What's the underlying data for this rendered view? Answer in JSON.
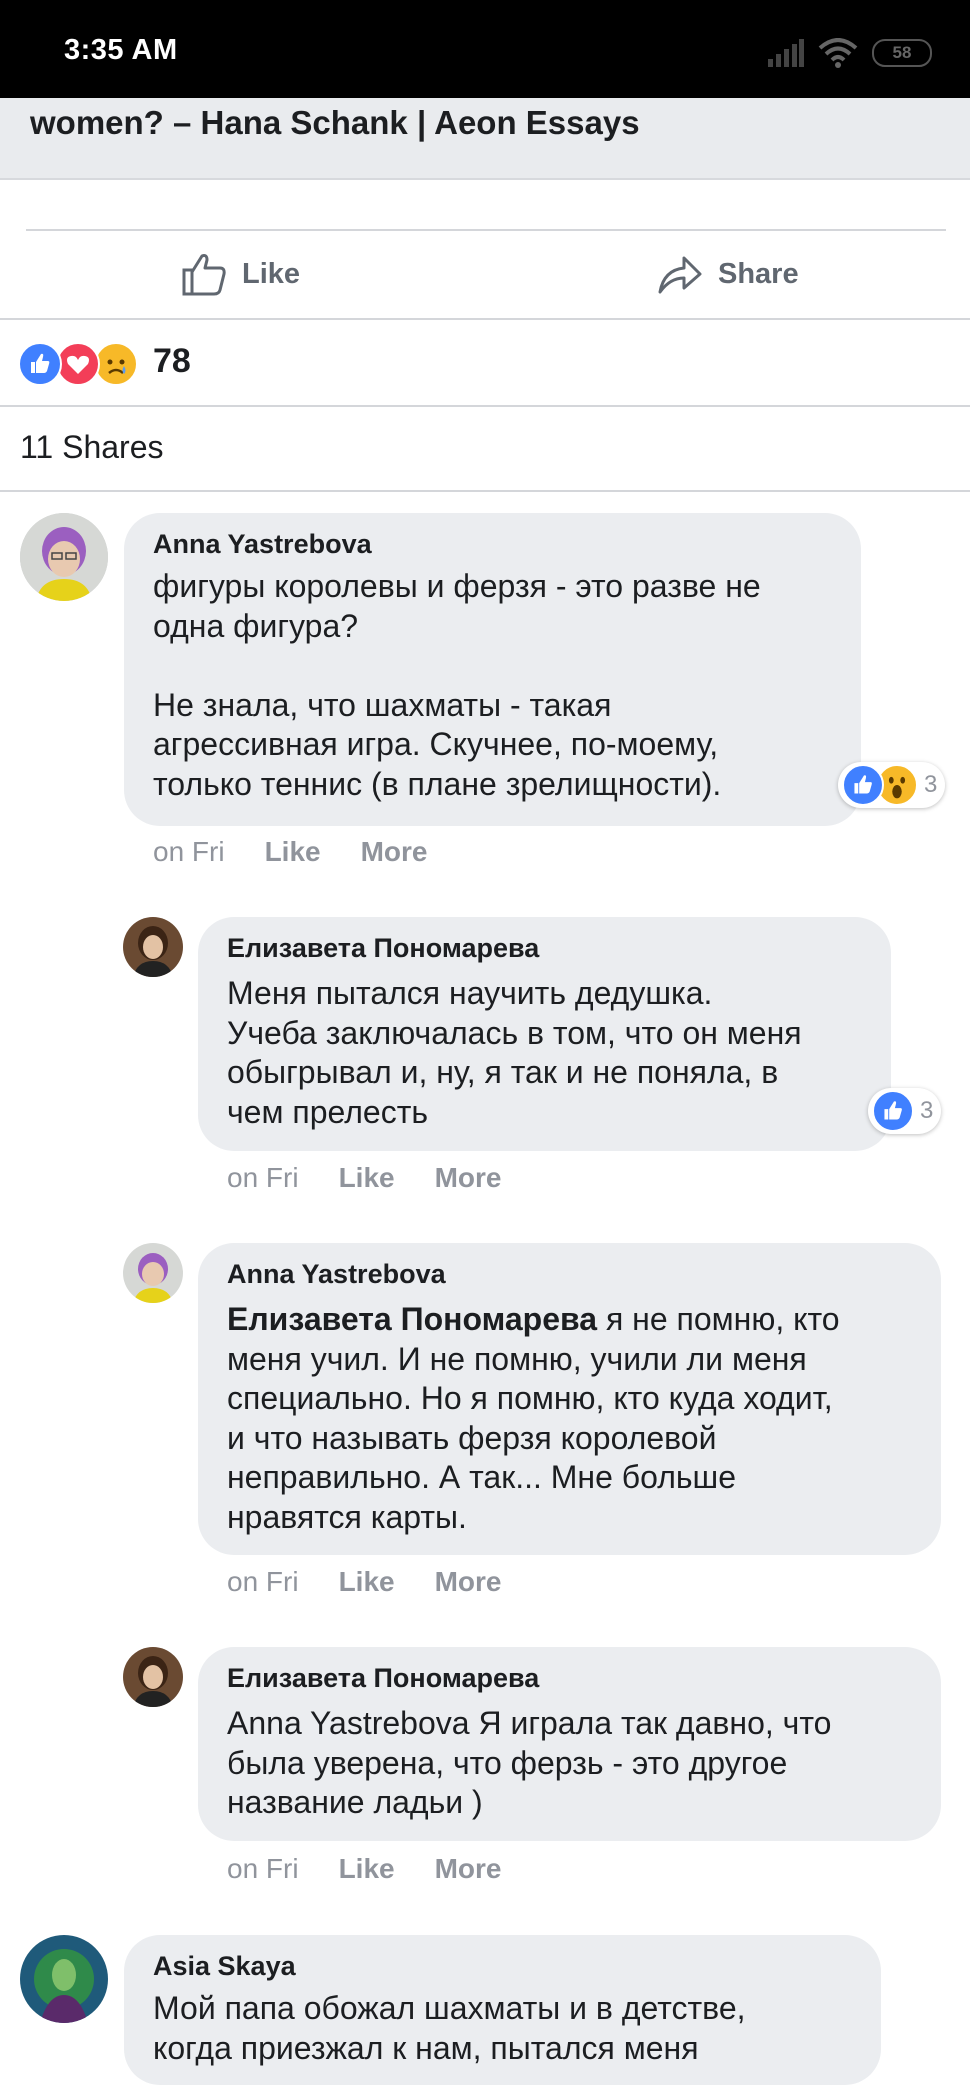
{
  "status_bar": {
    "time": "3:35 AM",
    "battery": "58"
  },
  "link": {
    "title": "women? – Hana Schank | Aeon Essays"
  },
  "actions": {
    "like_label": "Like",
    "share_label": "Share"
  },
  "reactions": {
    "count": "78"
  },
  "shares": {
    "label": "11 Shares"
  },
  "comments": [
    {
      "author": "Anna Yastrebova",
      "text": "фигуры королевы и ферзя - это разве не\nодна фигура?\n\nНе знала, что шахматы - такая\nагрессивная игра. Скучнее, по-моему,\nтолько теннис (в плане зрелищности).",
      "time": "on Fri",
      "like": "Like",
      "more": "More",
      "reaction_count": "3"
    },
    {
      "author": "Елизавета Пономарева",
      "text": "Меня пытался научить дедушка.\nУчеба заключалась в том, что он меня\nобыгрывал и, ну, я так и не поняла, в\nчем прелесть",
      "time": "on Fri",
      "like": "Like",
      "more": "More",
      "reaction_count": "3"
    },
    {
      "author": "Anna Yastrebova",
      "mention": "Елизавета Пономарева",
      "text": " я не помню, кто\nменя учил. И не помню, учили ли меня\nспециально. Но я помню, кто куда ходит,\nи что называть ферзя королевой\nнеправильно. А так... Мне больше\nнравятся карты.",
      "time": "on Fri",
      "like": "Like",
      "more": "More"
    },
    {
      "author": "Елизавета Пономарева",
      "text": "Anna Yastrebova Я играла так давно, что\nбыла уверена, что ферзь - это другое\nназвание ладьи )",
      "time": "on Fri",
      "like": "Like",
      "more": "More"
    },
    {
      "author": "Asia Skaya",
      "text": "Мой папа обожал шахматы и в детстве,\nкогда приезжал к нам, пытался меня"
    }
  ],
  "colors": {
    "like_blue": "#4080ff",
    "love_red": "#f33e58",
    "sad_yellow": "#f7b928",
    "bubble": "#ebedf0",
    "meta_gray": "#90949c"
  }
}
